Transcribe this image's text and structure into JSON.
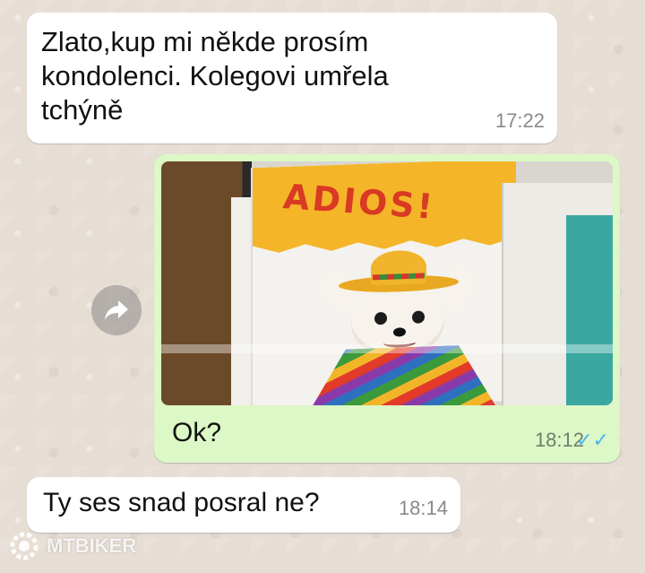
{
  "chat": {
    "messages": [
      {
        "type": "incoming",
        "text": "Zlato,kup mi někde prosím kondolenci. Kolegovi umřela tchýně",
        "time": "17:22"
      },
      {
        "type": "outgoing",
        "media": "photo",
        "media_text": "ADIOS!",
        "caption": "Ok?",
        "time": "18:12",
        "status_icon": "double-check-icon",
        "status_color": "#4fb4f0"
      },
      {
        "type": "incoming",
        "text": "Ty ses snad posral ne?",
        "time": "18:14"
      }
    ],
    "forward_icon": "forward-arrow-icon"
  },
  "watermark": {
    "text": "MTBIKER",
    "icon": "gear-logo-icon"
  },
  "colors": {
    "incoming_bubble": "#ffffff",
    "outgoing_bubble": "#dcf8c6",
    "background": "#e6ddd4"
  }
}
